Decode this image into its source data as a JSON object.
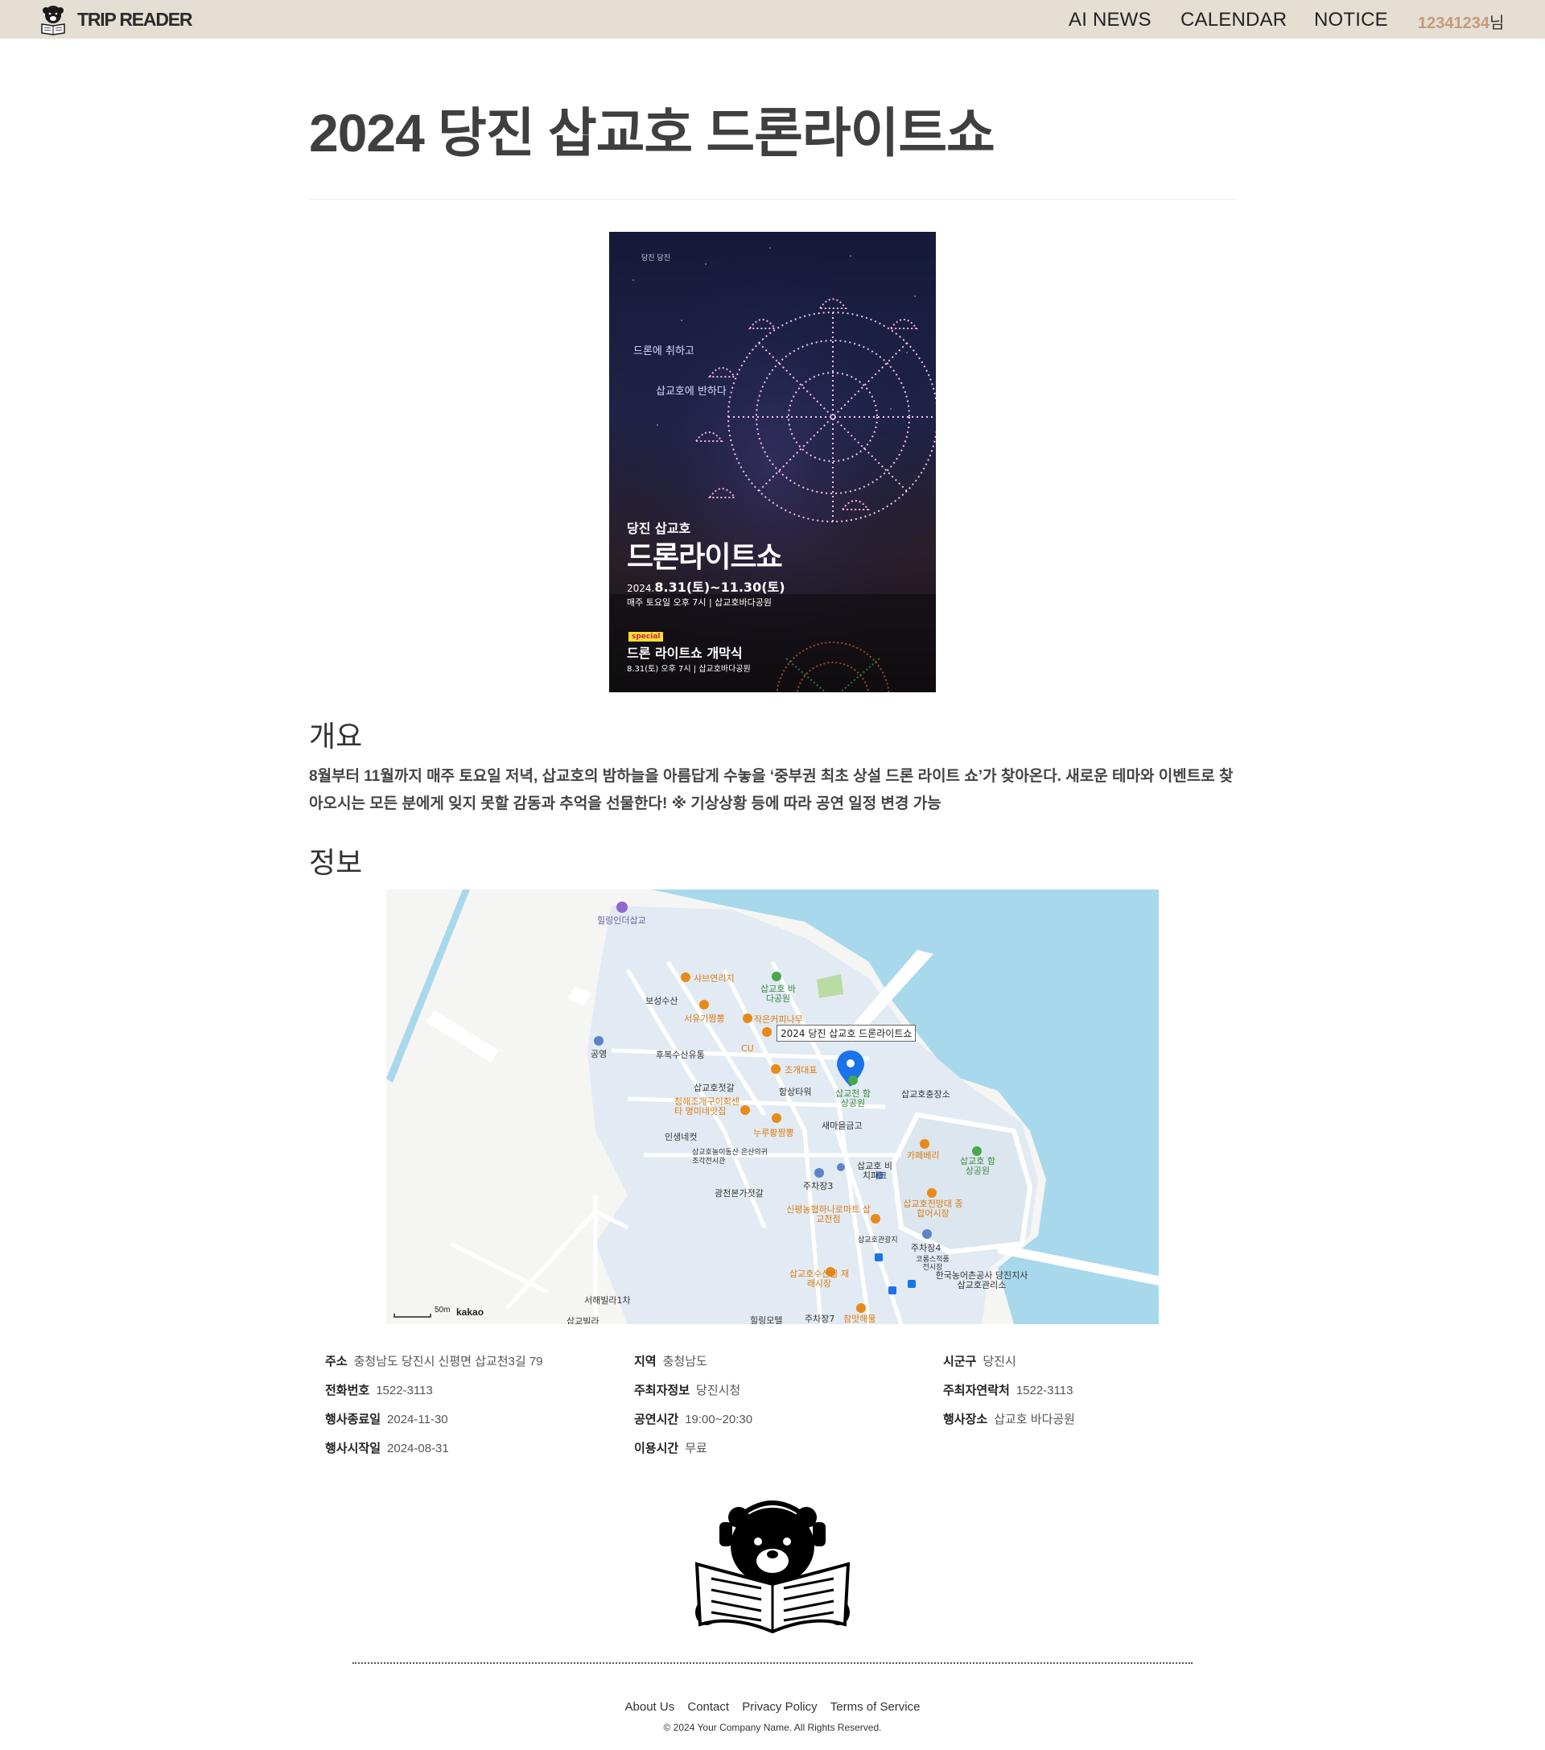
{
  "navbar": {
    "brand": "TRIP READER",
    "links": [
      "AI NEWS",
      "CALENDAR",
      "NOTICE"
    ],
    "user_name": "12341234",
    "user_suffix": "님"
  },
  "page": {
    "title": "2024 당진 삽교호 드론라이트쇼"
  },
  "poster": {
    "logo_text": "당진 당진",
    "side_text_1": "드론에 취하고",
    "side_text_2": "삽교호에 반하다",
    "subtitle": "당진 삽교호",
    "main_title": "드론라이트쇼",
    "date_prefix": "2024.",
    "date_range": "8.31(토)~11.30(토)",
    "time_line": "매주 토요일 오후 7시 | 삽교호바다공원",
    "badge": "special",
    "special_title": "드론 라이트쇼 개막식",
    "special_detail": "8.31(토) 오후 7시 | 삽교호바다공원"
  },
  "sections": {
    "overview_heading": "개요",
    "overview_text": "8월부터 11월까지 매주 토요일 저녁, 삽교호의 밤하늘을 아름답게 수놓을 ‘중부권 최초 상설 드론 라이트 쇼’가 찾아온다. 새로운 테마와 이벤트로 찾아오시는 모든 분에게 잊지 못할 감동과 추억을 선물한다! ※ 기상상황 등에 따라 공연 일정 변경 가능",
    "info_heading": "정보"
  },
  "map": {
    "marker_label": "2024 당진 삽교호 드론라이트쇼",
    "scale": "50m",
    "brand": "kakao",
    "labels": [
      {
        "text": "힐링인더삽교",
        "kind": "purple"
      },
      {
        "text": "샤브연리지",
        "kind": "orange"
      },
      {
        "text": "삽교호 바다공원",
        "kind": "green"
      },
      {
        "text": "보성수산",
        "kind": "plain"
      },
      {
        "text": "서유기짬뽕",
        "kind": "orange"
      },
      {
        "text": "작은커피나무",
        "kind": "orange"
      },
      {
        "text": "CU",
        "kind": "orange"
      },
      {
        "text": "공영",
        "kind": "plain"
      },
      {
        "text": "후복수산유통",
        "kind": "plain"
      },
      {
        "text": "조개대표",
        "kind": "orange"
      },
      {
        "text": "삽교호젓갈",
        "kind": "plain"
      },
      {
        "text": "함상타워",
        "kind": "plain"
      },
      {
        "text": "삽교천 함상공원",
        "kind": "green"
      },
      {
        "text": "삽교호충장소",
        "kind": "plain"
      },
      {
        "text": "청해조개구이회센타 명미네맛집",
        "kind": "orange"
      },
      {
        "text": "누루황짬뽕",
        "kind": "orange"
      },
      {
        "text": "새마을금고",
        "kind": "plain"
      },
      {
        "text": "인생네컷",
        "kind": "plain"
      },
      {
        "text": "삽교호놀이동산 은산의귀조각전시관",
        "kind": "plain"
      },
      {
        "text": "카페베리",
        "kind": "orange"
      },
      {
        "text": "삽교호 함상공원",
        "kind": "green"
      },
      {
        "text": "주차장3",
        "kind": "plain"
      },
      {
        "text": "삽교호 비치파크",
        "kind": "plain"
      },
      {
        "text": "광천본가젓갈",
        "kind": "plain"
      },
      {
        "text": "신평농협하나로마트 삽교천점",
        "kind": "orange"
      },
      {
        "text": "삽교호전망대 종합어시장",
        "kind": "orange"
      },
      {
        "text": "삽교호관광지",
        "kind": "plain"
      },
      {
        "text": "주차장4",
        "kind": "plain"
      },
      {
        "text": "코롬스적품 전시장",
        "kind": "plain"
      },
      {
        "text": "한국농어촌공사 당진지사 삽교호관리소",
        "kind": "plain"
      },
      {
        "text": "삽교호수산물 재래시장",
        "kind": "orange"
      },
      {
        "text": "서해빌라1차",
        "kind": "plain"
      },
      {
        "text": "삽교빌라",
        "kind": "plain"
      },
      {
        "text": "힐링모텔",
        "kind": "plain"
      },
      {
        "text": "주차장7",
        "kind": "plain"
      },
      {
        "text": "참맛해물",
        "kind": "orange"
      }
    ]
  },
  "info": [
    {
      "key": "주소",
      "value": "충청남도 당진시 신평면 삽교천3길 79"
    },
    {
      "key": "지역",
      "value": "충청남도"
    },
    {
      "key": "시군구",
      "value": "당진시"
    },
    {
      "key": "전화번호",
      "value": "1522-3113"
    },
    {
      "key": "주최자정보",
      "value": "당진시청"
    },
    {
      "key": "주최자연락처",
      "value": "1522-3113"
    },
    {
      "key": "행사종료일",
      "value": "2024-11-30"
    },
    {
      "key": "공연시간",
      "value": "19:00~20:30"
    },
    {
      "key": "행사장소",
      "value": "삽교호 바다공원"
    },
    {
      "key": "행사시작일",
      "value": "2024-08-31"
    },
    {
      "key": "이용시간",
      "value": "무료"
    }
  ],
  "footer": {
    "links": [
      "About Us",
      "Contact",
      "Privacy Policy",
      "Terms of Service"
    ],
    "copyright": "© 2024 Your Company Name. All Rights Reserved."
  },
  "colors": {
    "navbar_bg": "#e5dfd3",
    "username": "#c49a7a",
    "map_water": "#a8d8ec",
    "map_land": "#e2ebf3",
    "marker": "#1a73e8"
  }
}
